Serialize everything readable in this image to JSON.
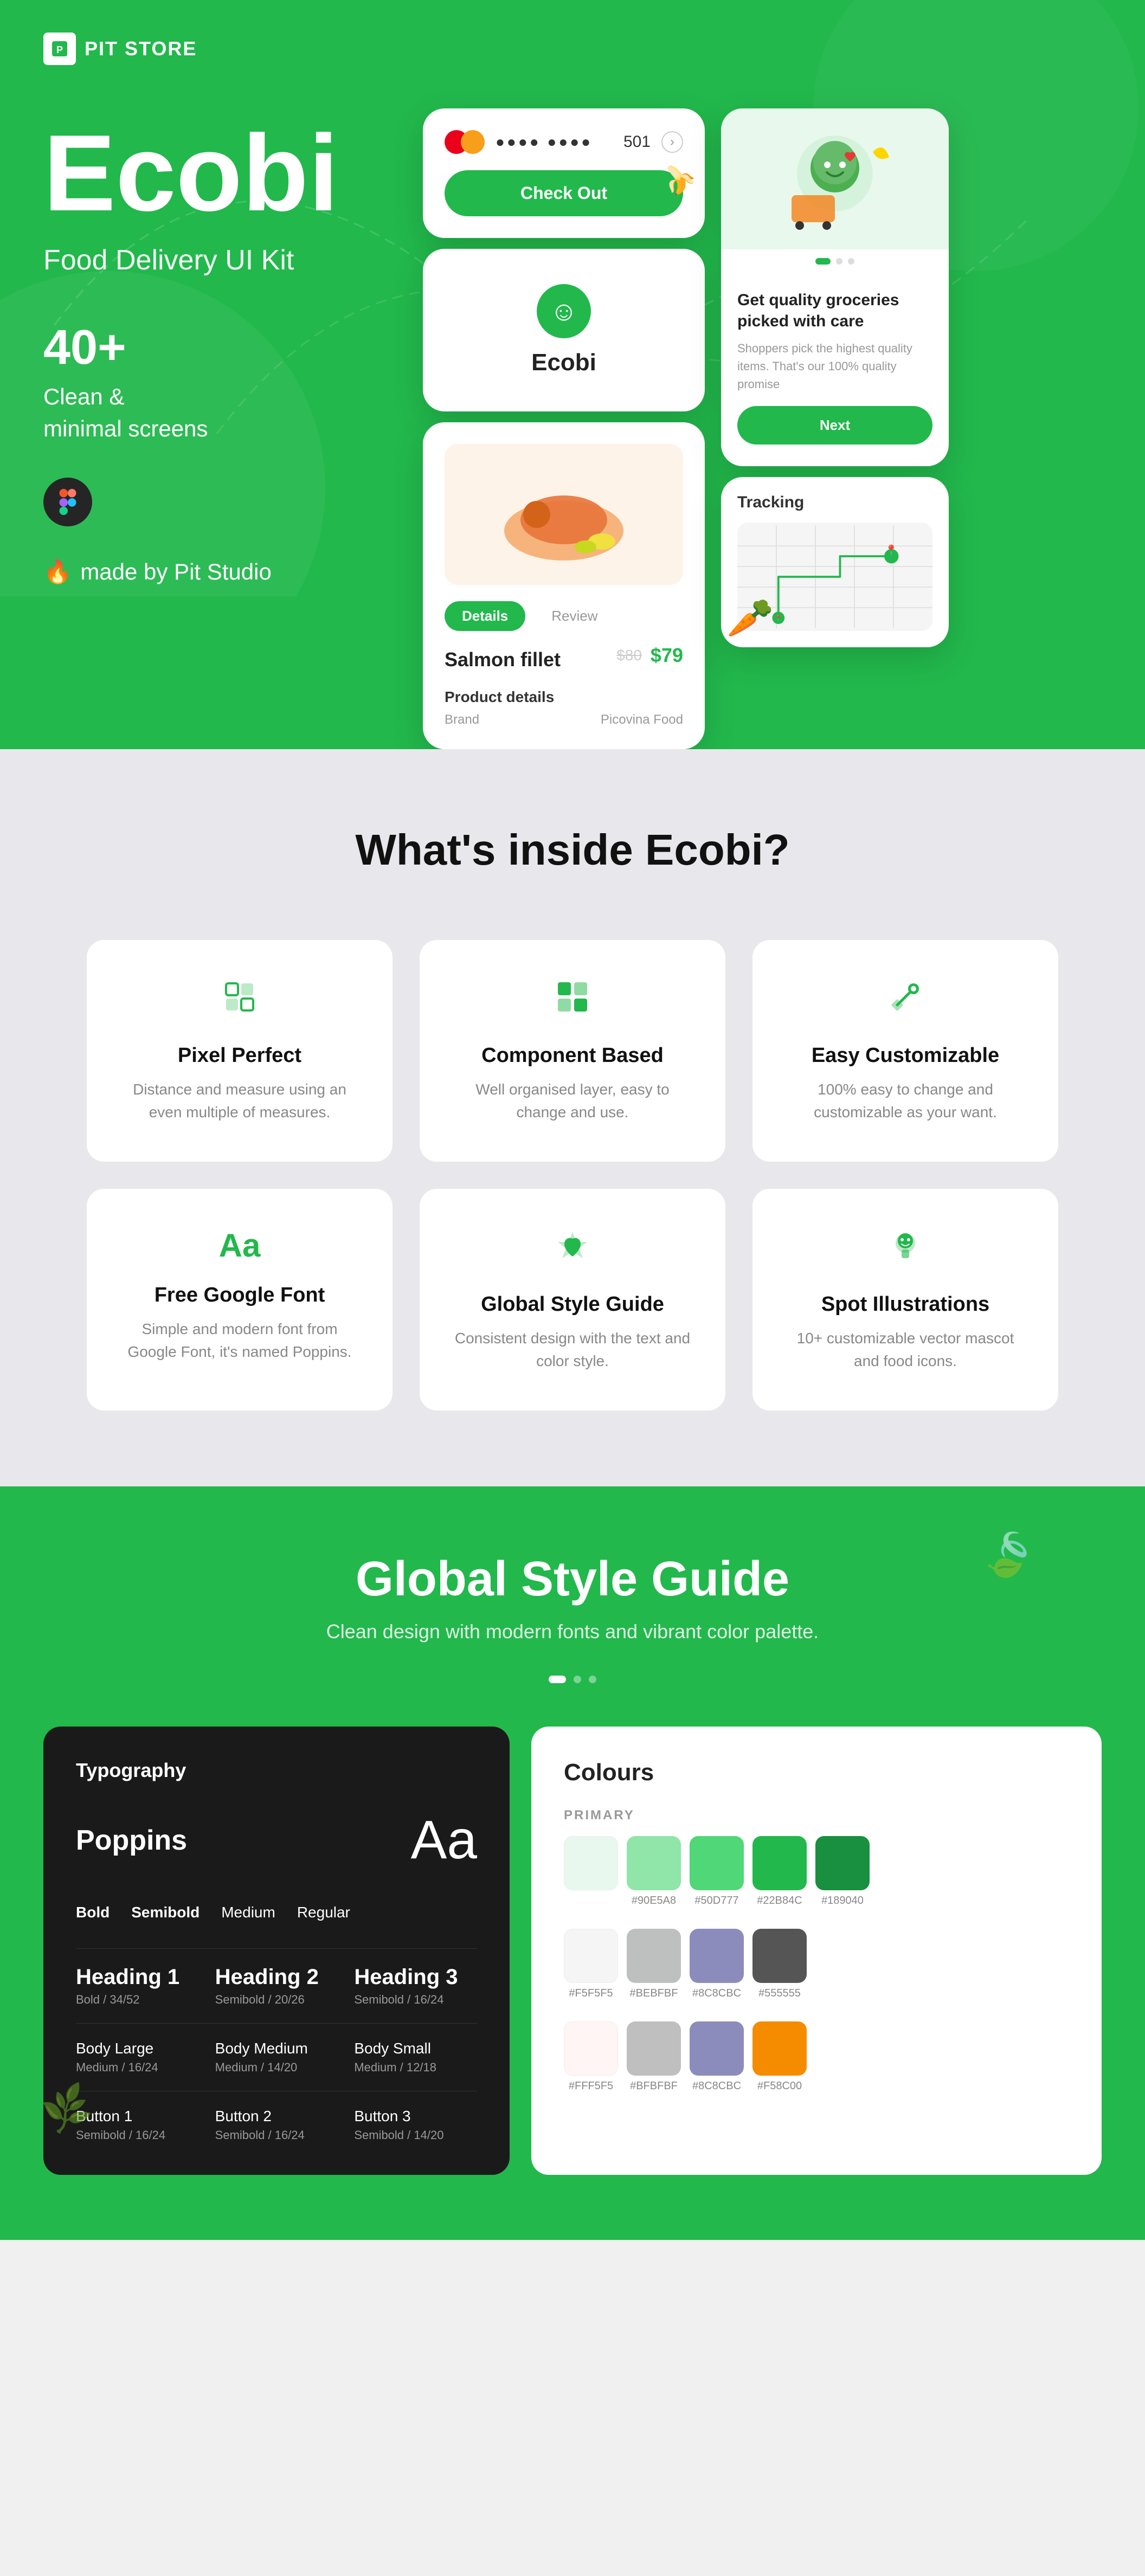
{
  "hero": {
    "logo": "PIT STORE",
    "title": "Ecobi",
    "subtitle": "Food Delivery UI Kit",
    "stats": "40+",
    "stats_sub": "Clean &\nminimal screens",
    "figma_icon": "Figma",
    "made_by": "made by Pit Studio",
    "fire_emoji": "🔥",
    "checkout": {
      "card_dots": "●●●●  ●●●●",
      "card_number": "501",
      "button": "Check Out"
    },
    "onboarding": {
      "headline": "Get quality groceries picked with care",
      "body": "Shoppers pick the highest quality items. That's our 100% quality promise",
      "next_button": "Next"
    },
    "product": {
      "tab1": "Details",
      "tab2": "Review",
      "name": "Salmon fillet",
      "price_old": "$80",
      "price_new": "$79",
      "details_label": "Product details",
      "brand_label": "Brand",
      "brand_value": "Picovina Food"
    },
    "ecobi_logo": "Ecobi",
    "tracking_label": "Tracking"
  },
  "inside": {
    "title": "What's inside Ecobi?",
    "features": [
      {
        "icon": "📐",
        "title": "Pixel Perfect",
        "desc": "Distance and measure using an even multiple of measures."
      },
      {
        "icon": "🧩",
        "title": "Component Based",
        "desc": "Well organised layer, easy to change and use."
      },
      {
        "icon": "✏️",
        "title": "Easy Customizable",
        "desc": "100% easy to change and customizable as your want."
      },
      {
        "icon": "Aa",
        "title": "Free Google Font",
        "desc": "Simple and modern font from Google Font, it's named Poppins."
      },
      {
        "icon": "🎨",
        "title": "Global Style Guide",
        "desc": "Consistent design with the text and color style."
      },
      {
        "icon": "🎭",
        "title": "Spot Illustrations",
        "desc": "10+ customizable vector mascot and food icons."
      }
    ]
  },
  "style_guide": {
    "title": "Global Style Guide",
    "subtitle": "Clean design with modern fonts and vibrant color palette.",
    "typography_title": "Typography",
    "font_name": "Poppins",
    "font_sample": "Aa",
    "weights": [
      "Bold",
      "Semibold",
      "Medium",
      "Regular"
    ],
    "headings": [
      {
        "label": "Heading 1",
        "spec": "Bold / 34/52"
      },
      {
        "label": "Heading 2",
        "spec": "Semibold / 20/26"
      },
      {
        "label": "Heading 3",
        "spec": "Semibold / 16/24"
      }
    ],
    "bodies": [
      {
        "label": "Body Large",
        "spec": "Medium / 16/24"
      },
      {
        "label": "Body Medium",
        "spec": "Medium / 14/20"
      },
      {
        "label": "Body Small",
        "spec": "Medium / 12/18"
      }
    ],
    "buttons": [
      {
        "label": "Button 1",
        "spec": "Semibold / 16/24"
      },
      {
        "label": "Button 2",
        "spec": "Semibold / 16/24"
      },
      {
        "label": "Button 3",
        "spec": "Semibold / 14/20"
      }
    ],
    "colours_title": "Colours",
    "primary_label": "PRIMARY",
    "primary_swatches": [
      {
        "color": "#E8F8EE",
        "label": ""
      },
      {
        "color": "#90E5A8",
        "label": "#90E5A8"
      },
      {
        "color": "#50D777",
        "label": "#50D777"
      },
      {
        "color": "#22B84C",
        "label": "#22B84C"
      },
      {
        "color": "#189040",
        "label": "#189040"
      }
    ],
    "neutral_swatches": [
      {
        "color": "#F5F5F5",
        "label": "#F5F5F5"
      },
      {
        "color": "#BEBFBF",
        "label": "#BEBFBF"
      },
      {
        "color": "#8C8CBC",
        "label": "#8C8CBC"
      },
      {
        "color": "#555555",
        "label": "#555555"
      }
    ],
    "accent_swatches": [
      {
        "color": "#FFF5F5",
        "label": "#FFF5F5"
      },
      {
        "color": "#BFBFBF",
        "label": "#BFBFBF"
      },
      {
        "color": "#8C8CBC",
        "label": "#8C8CBC"
      },
      {
        "color": "#F58C00",
        "label": "#F58C00"
      }
    ]
  }
}
